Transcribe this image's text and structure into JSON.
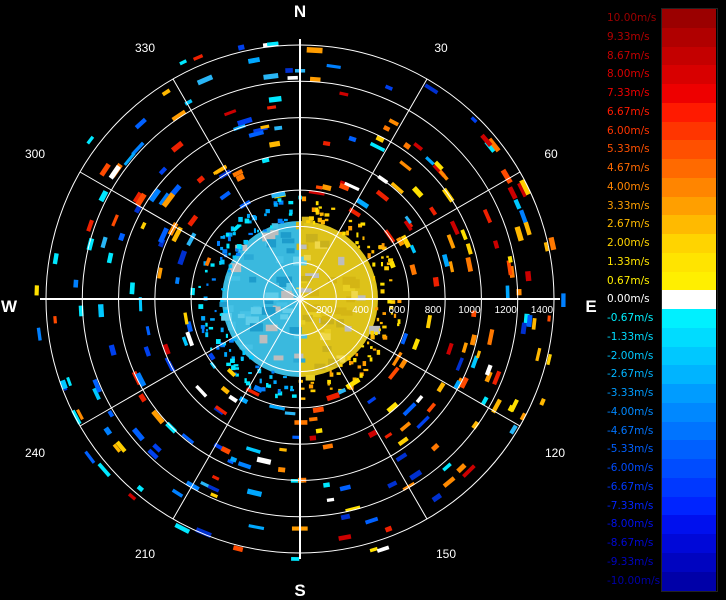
{
  "chart_data": {
    "type": "polar",
    "title": "",
    "cardinals": {
      "north": "N",
      "south": "S",
      "east": "E",
      "west": "W"
    },
    "angle_labels": [
      "30",
      "60",
      "120",
      "150",
      "210",
      "240",
      "300",
      "330"
    ],
    "range_ticks": [
      "200",
      "400",
      "600",
      "800",
      "1000",
      "1200",
      "1400"
    ],
    "range_max": 1400,
    "colorbar": {
      "labels": [
        "10.00m/s",
        "9.33m/s",
        "8.67m/s",
        "8.00m/s",
        "7.33m/s",
        "6.67m/s",
        "6.00m/s",
        "5.33m/s",
        "4.67m/s",
        "4.00m/s",
        "3.33m/s",
        "2.67m/s",
        "2.00m/s",
        "1.33m/s",
        "0.67m/s",
        "0.00m/s",
        "-0.67m/s",
        "-1.33m/s",
        "-2.00m/s",
        "-2.67m/s",
        "-3.33m/s",
        "-4.00m/s",
        "-4.67m/s",
        "-5.33m/s",
        "-6.00m/s",
        "-6.67m/s",
        "-7.33m/s",
        "-8.00m/s",
        "-8.67m/s",
        "-9.33m/s",
        "-10.00m/s"
      ],
      "colors": [
        "#9b0000",
        "#b00000",
        "#c40000",
        "#d80000",
        "#ee0000",
        "#ff1a00",
        "#ff3500",
        "#ff5000",
        "#ff6a00",
        "#ff8500",
        "#ff9f00",
        "#ffba00",
        "#ffd400",
        "#ffe400",
        "#ffef00",
        "#ffffff",
        "#00f0ff",
        "#00dcff",
        "#00c8ff",
        "#00b4ff",
        "#009cff",
        "#0088ff",
        "#0074ff",
        "#0060ff",
        "#004cff",
        "#0038ff",
        "#0024ff",
        "#0010ee",
        "#0008d8",
        "#0004c0",
        "#0000a8"
      ]
    }
  }
}
